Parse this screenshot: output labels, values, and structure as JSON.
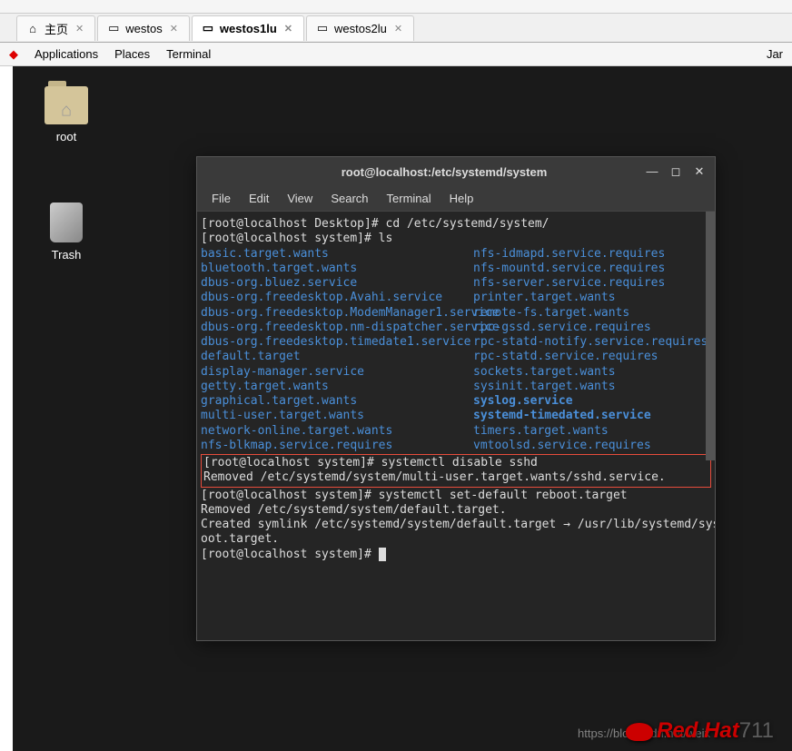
{
  "tabs": [
    {
      "label": "主页",
      "icon": "home"
    },
    {
      "label": "westos",
      "icon": "screen"
    },
    {
      "label": "westos1lu",
      "icon": "screen",
      "active": true
    },
    {
      "label": "westos2lu",
      "icon": "screen"
    }
  ],
  "gnome": {
    "applications": "Applications",
    "places": "Places",
    "terminal": "Terminal",
    "clock_partial": "Jar"
  },
  "desktop_icons": {
    "root": "root",
    "trash": "Trash"
  },
  "terminal": {
    "title": "root@localhost:/etc/systemd/system",
    "menu": [
      "File",
      "Edit",
      "View",
      "Search",
      "Terminal",
      "Help"
    ],
    "lines": {
      "l1": "[root@localhost Desktop]# cd /etc/systemd/system/",
      "l2": "[root@localhost system]# ls",
      "ls_col1": [
        "basic.target.wants",
        "bluetooth.target.wants",
        "dbus-org.bluez.service",
        "dbus-org.freedesktop.Avahi.service",
        "dbus-org.freedesktop.ModemManager1.service",
        "dbus-org.freedesktop.nm-dispatcher.service",
        "dbus-org.freedesktop.timedate1.service",
        "default.target",
        "display-manager.service",
        "getty.target.wants",
        "graphical.target.wants",
        "multi-user.target.wants",
        "network-online.target.wants",
        "nfs-blkmap.service.requires"
      ],
      "ls_col2": [
        "nfs-idmapd.service.requires",
        "nfs-mountd.service.requires",
        "nfs-server.service.requires",
        "printer.target.wants",
        "remote-fs.target.wants",
        "rpc-gssd.service.requires",
        "rpc-statd-notify.service.requires",
        "rpc-statd.service.requires",
        "sockets.target.wants",
        "sysinit.target.wants",
        "syslog.service",
        "systemd-timedated.service",
        "timers.target.wants",
        "vmtoolsd.service.requires"
      ],
      "ls_col2_bold_indices": [
        10,
        11
      ],
      "box1_l1": "[root@localhost system]# systemctl disable sshd",
      "box1_l2": "Removed /etc/systemd/system/multi-user.target.wants/sshd.service.",
      "l3": "[root@localhost system]# systemctl set-default reboot.target",
      "l4": "Removed /etc/systemd/system/default.target.",
      "l5": "Created symlink /etc/systemd/system/default.target → /usr/lib/systemd/system/reb",
      "l6": "oot.target.",
      "l7": "[root@localhost system]# "
    }
  },
  "watermark": "https://blog.csdn.net/weix",
  "watermark_suffix": "711",
  "redhat": "Red Hat"
}
